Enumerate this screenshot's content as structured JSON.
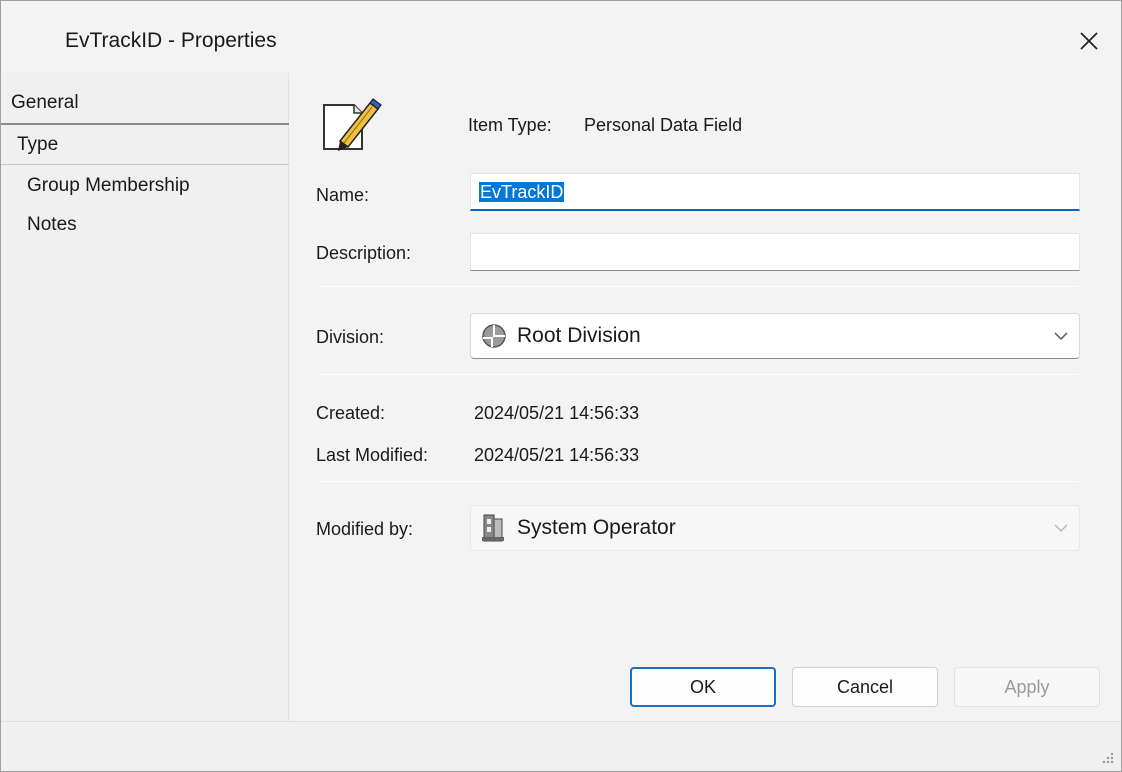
{
  "window": {
    "title": "EvTrackID - Properties"
  },
  "sidebar": {
    "items": [
      {
        "label": "General"
      },
      {
        "label": "Type"
      },
      {
        "label": "Group Membership"
      },
      {
        "label": "Notes"
      }
    ]
  },
  "general": {
    "item_type_label": "Item Type:",
    "item_type_value": "Personal Data Field",
    "icon": "pencil-document-icon",
    "name_label": "Name:",
    "name_value": "EvTrackID",
    "description_label": "Description:",
    "description_value": "",
    "division_label": "Division:",
    "division_value": "Root Division",
    "division_icon": "division-icon",
    "created_label": "Created:",
    "created_value": "2024/05/21 14:56:33",
    "last_modified_label": "Last Modified:",
    "last_modified_value": "2024/05/21 14:56:33",
    "modified_by_label": "Modified by:",
    "modified_by_value": "System Operator",
    "modified_by_icon": "operator-icon"
  },
  "buttons": {
    "ok": "OK",
    "cancel": "Cancel",
    "apply": "Apply"
  },
  "colors": {
    "accent": "#0067c0",
    "selection": "#0078d7",
    "disabled_text": "#9a9a9a"
  }
}
